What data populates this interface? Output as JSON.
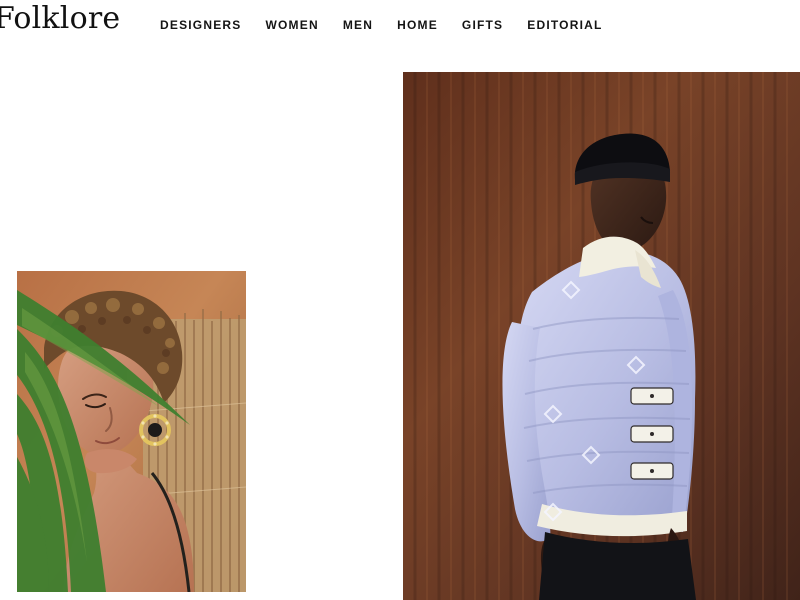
{
  "brand": {
    "logo_text": "Folklore"
  },
  "nav": {
    "items": [
      {
        "label": "DESIGNERS"
      },
      {
        "label": "WOMEN"
      },
      {
        "label": "MEN"
      },
      {
        "label": "HOME"
      },
      {
        "label": "GIFTS"
      },
      {
        "label": "EDITORIAL"
      }
    ]
  },
  "colors": {
    "background": "#ffffff",
    "text": "#141414",
    "left_photo_bg": "#c78558",
    "right_photo_bg": "#6d3b24",
    "jacket": "#b8bde3"
  },
  "images": {
    "left": {
      "kind": "editorial-photo"
    },
    "right": {
      "kind": "editorial-photo"
    }
  }
}
